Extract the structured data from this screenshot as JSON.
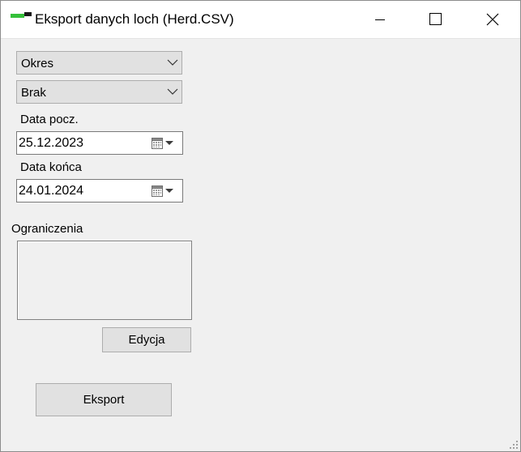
{
  "window": {
    "title": "Eksport danych loch (Herd.CSV)",
    "controls": [
      "minimize-icon",
      "maximize-icon",
      "close-icon"
    ]
  },
  "form": {
    "period_combo": {
      "value": "Okres"
    },
    "group_combo": {
      "value": "Brak"
    },
    "start_date": {
      "label": "Data pocz.",
      "value": "25.12.2023"
    },
    "end_date": {
      "label": "Data końca",
      "value": "24.01.2024"
    },
    "constraints": {
      "label": "Ograniczenia",
      "items": []
    },
    "edit_button": "Edycja",
    "export_button": "Eksport"
  },
  "colors": {
    "accent_green": "#35c03a",
    "window_bg": "#f0f0f0",
    "button_bg": "#e1e1e1"
  }
}
